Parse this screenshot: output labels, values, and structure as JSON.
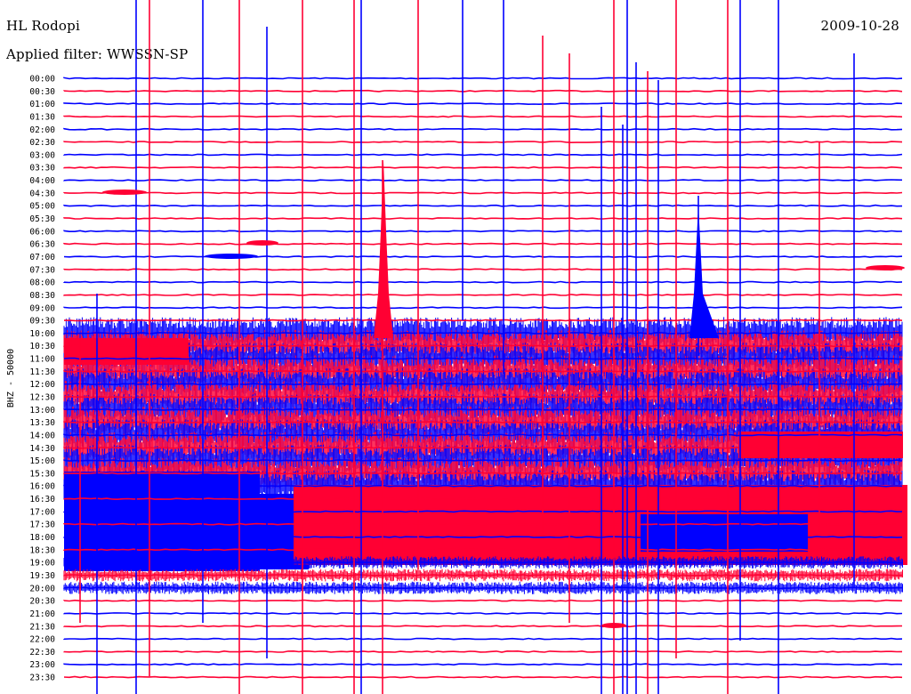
{
  "header": {
    "station": "HL Rodopi",
    "date": "2009-10-28",
    "filter_label": "Applied filter: WWSSN-SP"
  },
  "chart_data": {
    "type": "helicorder",
    "ylabel": "BHZ - 50000",
    "trace_interval_min": 30,
    "colors": {
      "even_row": "#0000ff",
      "odd_row": "#ff0033",
      "background": "#ffffff"
    },
    "rows": [
      "00:00",
      "00:30",
      "01:00",
      "01:30",
      "02:00",
      "02:30",
      "03:00",
      "03:30",
      "04:00",
      "04:30",
      "05:00",
      "05:30",
      "06:00",
      "06:30",
      "07:00",
      "07:30",
      "08:00",
      "08:30",
      "09:00",
      "09:30",
      "10:00",
      "10:30",
      "11:00",
      "11:30",
      "12:00",
      "12:30",
      "13:00",
      "13:30",
      "14:00",
      "14:30",
      "15:00",
      "15:30",
      "16:00",
      "16:30",
      "17:00",
      "17:30",
      "18:00",
      "18:30",
      "19:00",
      "19:30",
      "20:00",
      "20:30",
      "21:00",
      "21:30",
      "22:00",
      "22:30",
      "23:00",
      "23:30"
    ]
  }
}
